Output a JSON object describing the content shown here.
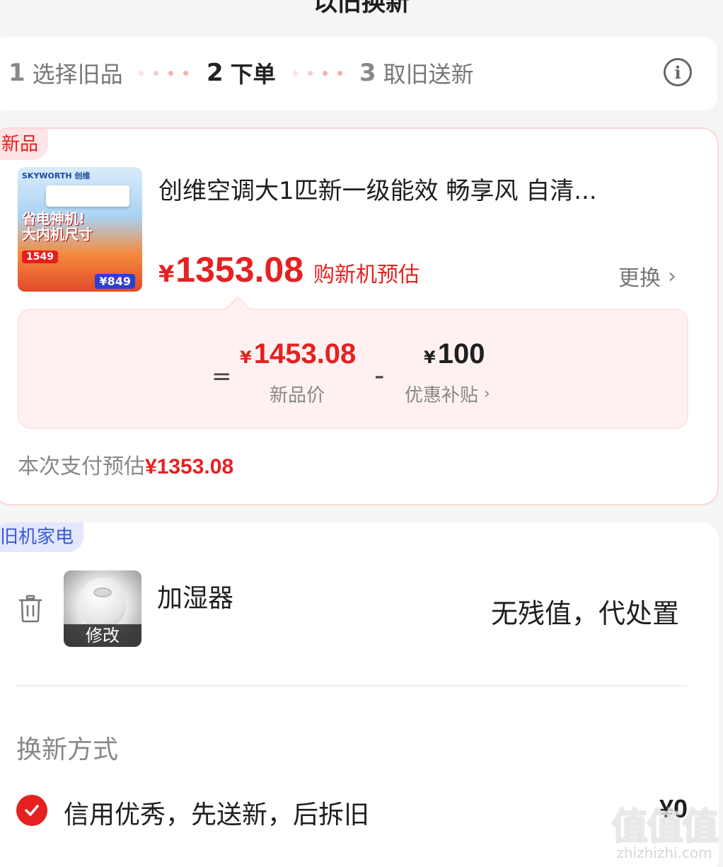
{
  "page": {
    "title": "以旧换新"
  },
  "steps": [
    {
      "num": "1",
      "label": "选择旧品"
    },
    {
      "num": "2",
      "label": "下单"
    },
    {
      "num": "3",
      "label": "取旧送新"
    }
  ],
  "new_product": {
    "tag": "新品",
    "title": "创维空调大1匹新一级能效 畅享风 自清...",
    "image": {
      "brand": "SKYWORTH 创维",
      "slogan_line1": "省电神机!",
      "slogan_line2": "大内机尺寸",
      "price_badge_1": "1549",
      "price_badge_2": "¥849"
    },
    "currency": "¥",
    "price": "1353.08",
    "price_note": "购新机预估",
    "change_label": "更换",
    "calc": {
      "equals": "=",
      "new_price": "1453.08",
      "new_price_label": "新品价",
      "minus": "-",
      "subsidy": "100",
      "subsidy_label": "优惠补贴"
    },
    "pay_label": "本次支付预估",
    "pay_amount": "¥1353.08"
  },
  "old_appliance": {
    "tag": "旧机家电",
    "name": "加湿器",
    "edit_label": "修改",
    "value_text": "无残值，代处置",
    "method_title": "换新方式",
    "method_label": "信用优秀，先送新，后拆旧",
    "method_price": "¥0"
  },
  "watermark": {
    "logo": "值值值",
    "text": "zhizhizhi.com"
  },
  "colors": {
    "accent_red": "#e52121",
    "tag_new_bg": "#ffe5e5",
    "tag_old_bg": "#e4e8ff",
    "tag_old_text": "#3a58d6"
  }
}
